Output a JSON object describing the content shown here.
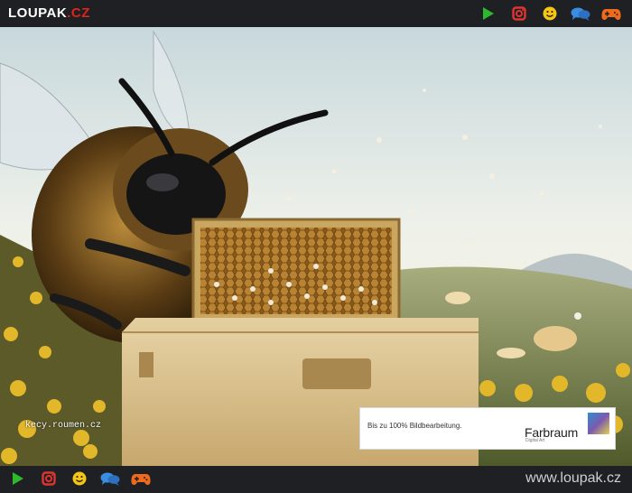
{
  "header": {
    "logo": "LOUPAK",
    "logo_tld": ".CZ",
    "icons": [
      "play-icon",
      "instagram-icon",
      "smiley-icon",
      "chat-bubbles-icon",
      "gamepad-icon"
    ]
  },
  "image": {
    "watermark": "kecy.roumen.cz",
    "ad": {
      "tagline": "Bis zu 100% Bildbearbeitung.",
      "brand": "Farbraum",
      "brand_sub": "Digital Art"
    }
  },
  "footer": {
    "icons": [
      "play-icon",
      "instagram-icon",
      "smiley-icon",
      "chat-bubbles-icon",
      "gamepad-icon"
    ],
    "site_url": "www.loupak.cz"
  },
  "colors": {
    "bar_bg": "#1e2024",
    "brand_red": "#e2231a",
    "play_green": "#2eb82e",
    "instagram_red": "#e0342f",
    "smiley_yellow": "#f5c518",
    "chat_blue": "#3a8de0",
    "gamepad_orange": "#f06a1c"
  }
}
